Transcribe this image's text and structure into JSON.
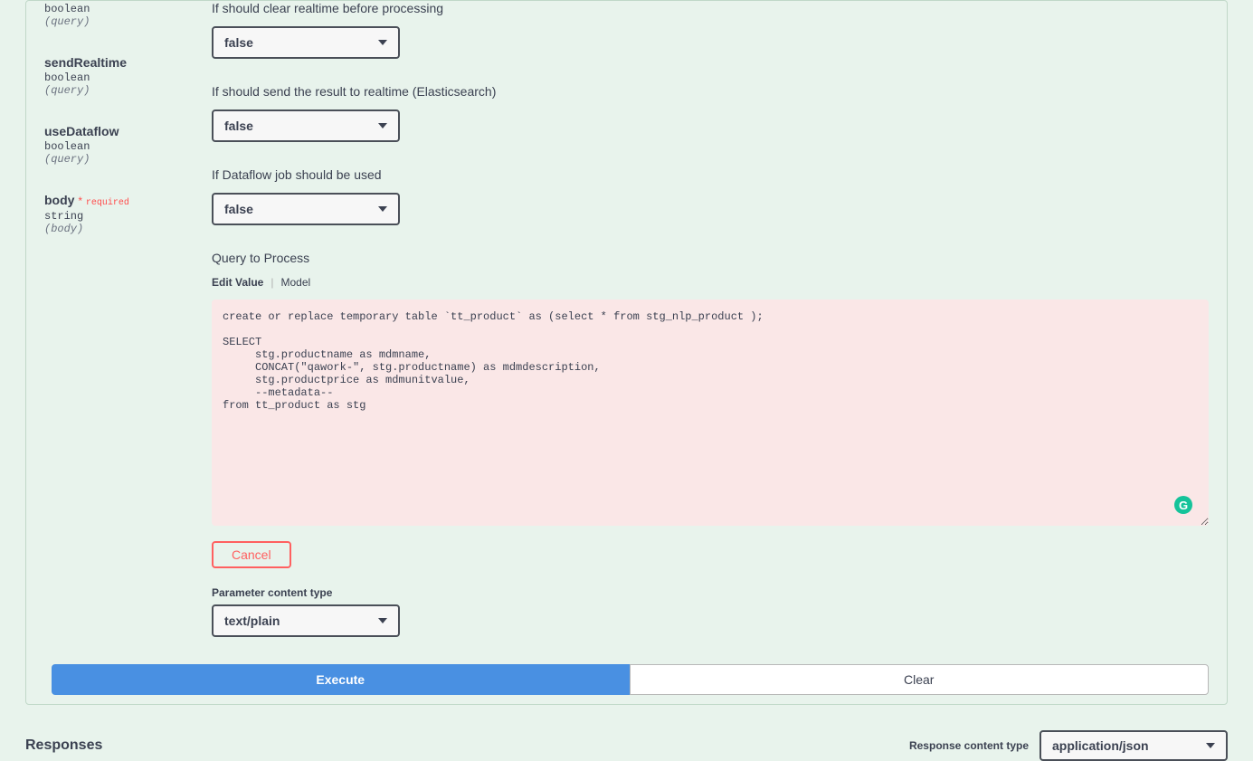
{
  "sidebar": {
    "param0": {
      "type": "boolean",
      "in": "(query)"
    },
    "param1": {
      "name": "sendRealtime",
      "type": "boolean",
      "in": "(query)"
    },
    "param2": {
      "name": "useDataflow",
      "type": "boolean",
      "in": "(query)"
    },
    "param3": {
      "name": "body",
      "required_star": "*",
      "required": "required",
      "type": "string",
      "in": "(body)"
    }
  },
  "content": {
    "desc0": "If should clear realtime before processing",
    "select0": "false",
    "desc1": "If should send the result to realtime (Elasticsearch)",
    "select1": "false",
    "desc2": "If Dataflow job should be used",
    "select2": "false",
    "desc3": "Query to Process",
    "tab_edit": "Edit Value",
    "tab_model": "Model",
    "body_value": "create or replace temporary table `tt_product` as (select * from stg_nlp_product );\n\nSELECT\n     stg.productname as mdmname,\n     CONCAT(\"qawork-\", stg.productname) as mdmdescription,\n     stg.productprice as mdmunitvalue,\n     --metadata--\nfrom tt_product as stg",
    "cancel": "Cancel",
    "content_type_label": "Parameter content type",
    "content_type_value": "text/plain"
  },
  "actions": {
    "execute": "Execute",
    "clear": "Clear"
  },
  "responses": {
    "title": "Responses",
    "content_type_label": "Response content type",
    "content_type_value": "application/json"
  },
  "grammarly": "G"
}
